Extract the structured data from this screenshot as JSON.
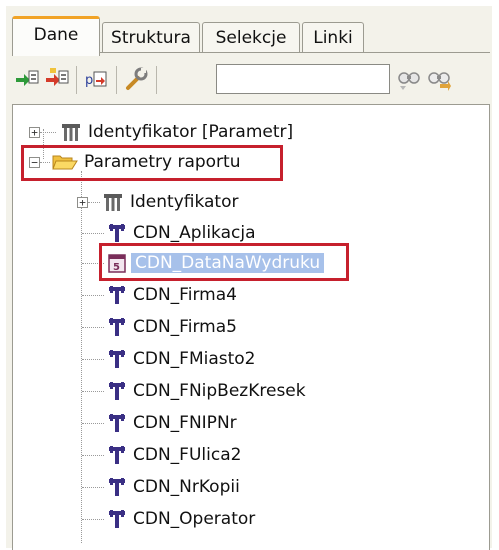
{
  "tabs": [
    {
      "label": "Dane"
    },
    {
      "label": "Struktura"
    },
    {
      "label": "Selekcje"
    },
    {
      "label": "Linki"
    }
  ],
  "toolbar": {
    "search_value": "",
    "icons": [
      "add-field-icon",
      "add-subfield-icon",
      "insert-text-icon",
      "properties-wrench-icon",
      "find-icon",
      "find-next-icon"
    ]
  },
  "tree": {
    "root1": "Identyfikator [Parametr]",
    "root2": "Parametry raportu",
    "children": [
      "Identyfikator",
      "CDN_Aplikacja",
      "CDN_DataNaWydruku",
      "CDN_Firma4",
      "CDN_Firma5",
      "CDN_FMiasto2",
      "CDN_FNipBezKresek",
      "CDN_FNIPNr",
      "CDN_FUlica2",
      "CDN_NrKopii",
      "CDN_Operator"
    ]
  },
  "colors": {
    "highlight_box": "#c6202d",
    "selection": "#a7c1ea",
    "tab_accent": "#f1a326",
    "text_icon": "#3a2f84"
  }
}
